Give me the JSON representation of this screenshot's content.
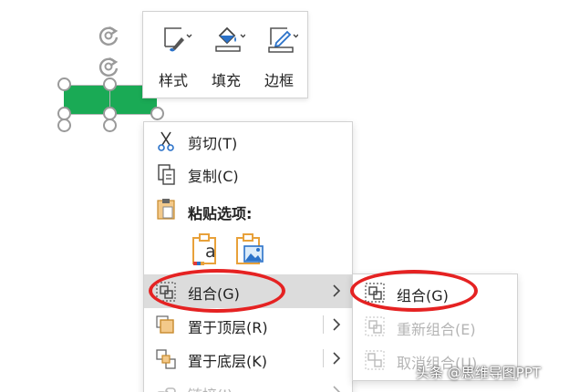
{
  "mini_toolbar": {
    "style_label": "样式",
    "fill_label": "填充",
    "border_label": "边框"
  },
  "context_menu": {
    "cut_label": "剪切(T)",
    "copy_label": "复制(C)",
    "paste_options_label": "粘贴选项:",
    "paste_text_icon_letter": "a",
    "group_label": "组合(G)",
    "bring_to_front_label": "置于顶层(R)",
    "send_to_back_label": "置于底层(K)",
    "link_label": "链接(I)"
  },
  "group_submenu": {
    "group_label": "组合(G)",
    "regroup_label": "重新组合(E)",
    "ungroup_label": "取消组合(U)"
  },
  "watermark": "头条 @思维导图PPT",
  "colors": {
    "shape_fill": "#1aaa55",
    "annotation": "#e52222",
    "hover_bg": "#dcdcdc",
    "disabled_text": "#b5b5b5",
    "paste_icon": "#e8a13a",
    "fill_bucket": "#2b72c9"
  }
}
